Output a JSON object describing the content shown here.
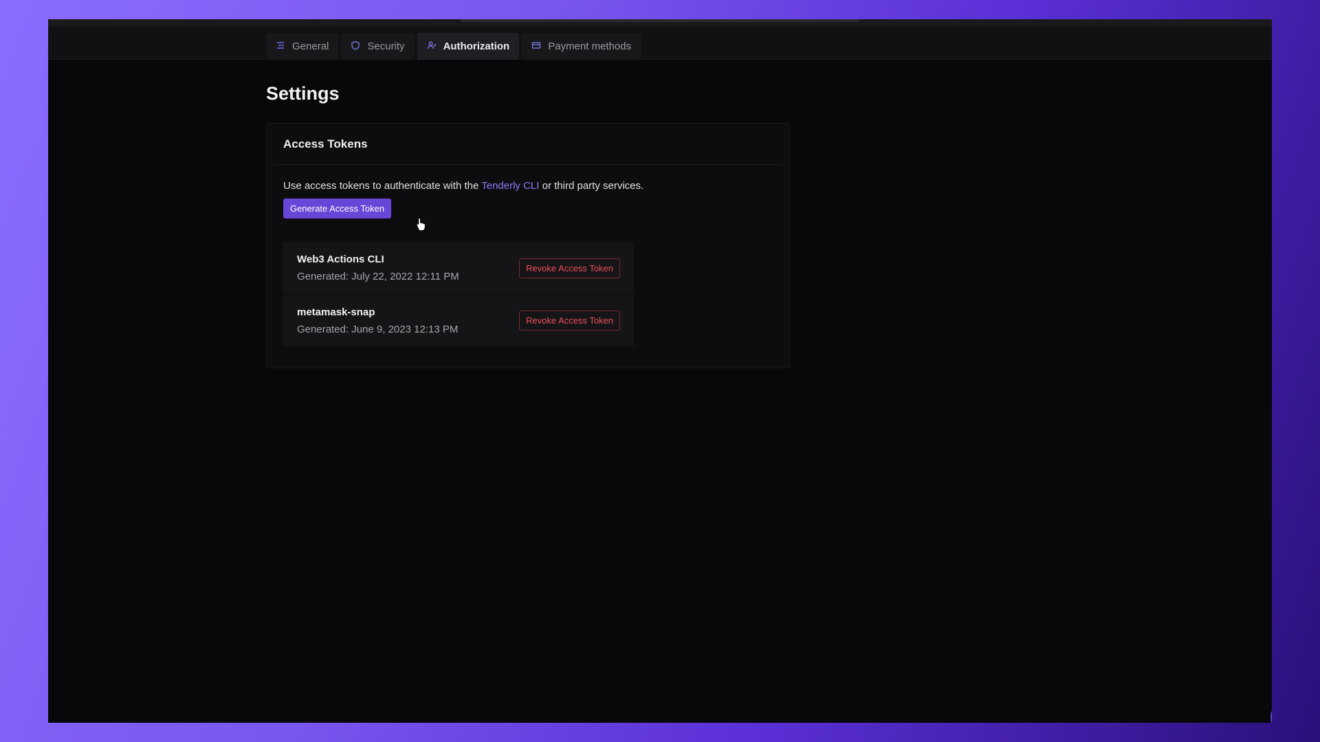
{
  "tabs": [
    {
      "label": "General",
      "icon": "list-icon",
      "active": false
    },
    {
      "label": "Security",
      "icon": "shield-icon",
      "active": false
    },
    {
      "label": "Authorization",
      "icon": "user-check-icon",
      "active": true
    },
    {
      "label": "Payment methods",
      "icon": "credit-card-icon",
      "active": false
    }
  ],
  "page": {
    "title": "Settings"
  },
  "access_tokens": {
    "header": "Access Tokens",
    "description_before": "Use access tokens to authenticate with the ",
    "description_link": "Tenderly CLI",
    "description_after": " or third party services.",
    "generate_label": "Generate Access Token",
    "tokens": [
      {
        "name": "Web3 Actions CLI",
        "generated": "Generated: July 22, 2022 12:11 PM",
        "revoke_label": "Revoke Access Token"
      },
      {
        "name": "metamask-snap",
        "generated": "Generated: June 9, 2023 12:13 PM",
        "revoke_label": "Revoke Access Token"
      }
    ]
  },
  "colors": {
    "accent": "#6846d8",
    "link": "#8e78f5",
    "danger": "#f0505a",
    "background": "#08080a"
  }
}
